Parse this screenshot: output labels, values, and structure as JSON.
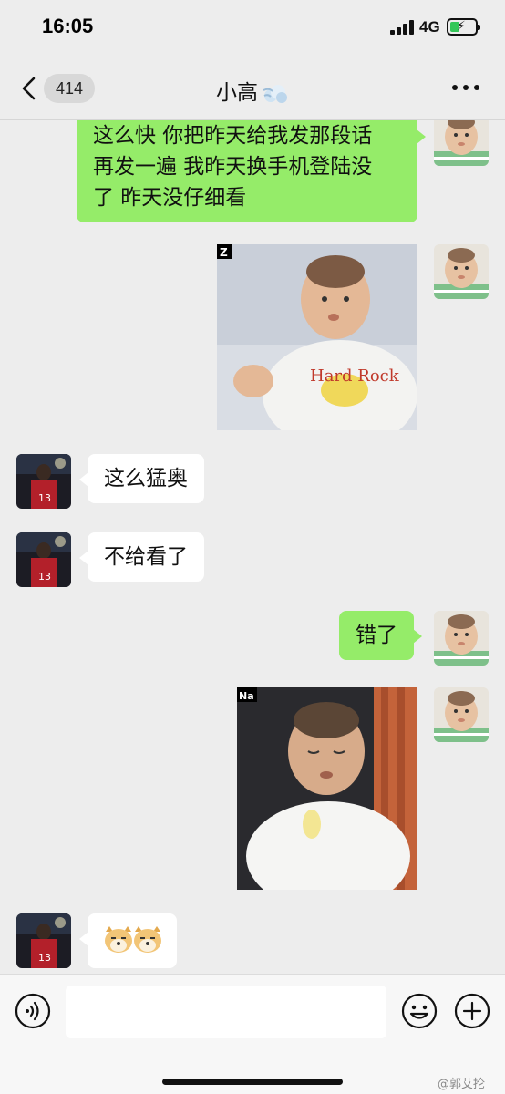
{
  "status_bar": {
    "time": "16:05",
    "network": "4G"
  },
  "nav": {
    "unread_count": "414",
    "title": "小高"
  },
  "messages": [
    {
      "side": "right",
      "type": "text",
      "text": "这么快 你把昨天给我发那段话\n再发一遍 我昨天换手机登陆没\n了 昨天没仔细看"
    },
    {
      "side": "right",
      "type": "sticker",
      "overlay": "Z",
      "shirt_text": "Hard Rock"
    },
    {
      "side": "left",
      "type": "text",
      "text": "这么猛奥"
    },
    {
      "side": "left",
      "type": "text",
      "text": "不给看了"
    },
    {
      "side": "right",
      "type": "text",
      "text": "错了"
    },
    {
      "side": "right",
      "type": "sticker",
      "overlay": "Na"
    },
    {
      "side": "left",
      "type": "emoji",
      "emoji_name": "doge-emoji"
    }
  ],
  "input_bar": {
    "placeholder": ""
  },
  "watermark": "@郭艾抡",
  "colors": {
    "bubble_self": "#95ec69",
    "bubble_other": "#ffffff",
    "background": "#ededed"
  },
  "icons": [
    "back-chevron-icon",
    "more-dots-icon",
    "voice-icon",
    "emoji-icon",
    "plus-icon",
    "cloud-puff-icon"
  ]
}
